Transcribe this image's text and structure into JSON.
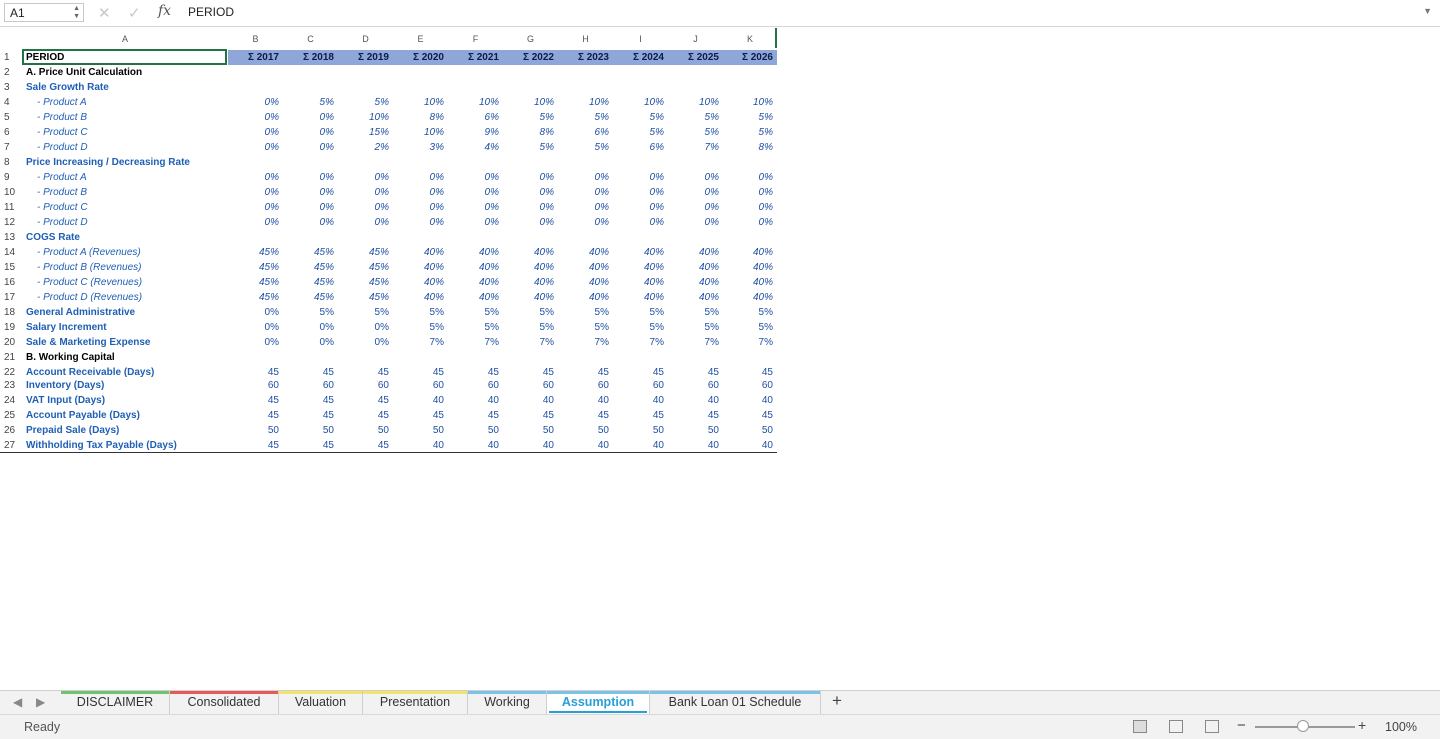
{
  "formula_bar": {
    "cell_ref": "A1",
    "fx": "fx",
    "formula": "PERIOD"
  },
  "columns": [
    "A",
    "B",
    "C",
    "D",
    "E",
    "F",
    "G",
    "H",
    "I",
    "J",
    "K"
  ],
  "header_row": {
    "label": "PERIOD",
    "years": [
      "Σ 2017",
      "Σ 2018",
      "Σ 2019",
      "Σ 2020",
      "Σ 2021",
      "Σ 2022",
      "Σ 2023",
      "Σ 2024",
      "Σ 2025",
      "Σ 2026"
    ]
  },
  "rows": [
    {
      "n": "1",
      "label": "PERIOD",
      "style": "header",
      "values": []
    },
    {
      "n": "2",
      "label": "A. Price Unit Calculation",
      "style": "black",
      "values": []
    },
    {
      "n": "3",
      "label": "Sale Growth Rate",
      "style": "blue",
      "values": []
    },
    {
      "n": "4",
      "label": "- Product A",
      "style": "sub",
      "pct": true,
      "values": [
        "0%",
        "5%",
        "5%",
        "10%",
        "10%",
        "10%",
        "10%",
        "10%",
        "10%",
        "10%"
      ]
    },
    {
      "n": "5",
      "label": "- Product B",
      "style": "sub",
      "pct": true,
      "values": [
        "0%",
        "0%",
        "10%",
        "8%",
        "6%",
        "5%",
        "5%",
        "5%",
        "5%",
        "5%"
      ]
    },
    {
      "n": "6",
      "label": "- Product C",
      "style": "sub",
      "pct": true,
      "values": [
        "0%",
        "0%",
        "15%",
        "10%",
        "9%",
        "8%",
        "6%",
        "5%",
        "5%",
        "5%"
      ]
    },
    {
      "n": "7",
      "label": "- Product D",
      "style": "sub",
      "pct": true,
      "values": [
        "0%",
        "0%",
        "2%",
        "3%",
        "4%",
        "5%",
        "5%",
        "6%",
        "7%",
        "8%"
      ]
    },
    {
      "n": "8",
      "label": "Price Increasing / Decreasing Rate",
      "style": "blue",
      "values": []
    },
    {
      "n": "9",
      "label": "- Product A",
      "style": "sub",
      "pct": true,
      "values": [
        "0%",
        "0%",
        "0%",
        "0%",
        "0%",
        "0%",
        "0%",
        "0%",
        "0%",
        "0%"
      ]
    },
    {
      "n": "10",
      "label": "- Product B",
      "style": "sub",
      "pct": true,
      "values": [
        "0%",
        "0%",
        "0%",
        "0%",
        "0%",
        "0%",
        "0%",
        "0%",
        "0%",
        "0%"
      ]
    },
    {
      "n": "11",
      "label": "- Product C",
      "style": "sub",
      "pct": true,
      "values": [
        "0%",
        "0%",
        "0%",
        "0%",
        "0%",
        "0%",
        "0%",
        "0%",
        "0%",
        "0%"
      ]
    },
    {
      "n": "12",
      "label": "- Product D",
      "style": "sub",
      "pct": true,
      "values": [
        "0%",
        "0%",
        "0%",
        "0%",
        "0%",
        "0%",
        "0%",
        "0%",
        "0%",
        "0%"
      ]
    },
    {
      "n": "13",
      "label": "COGS Rate",
      "style": "blue",
      "values": []
    },
    {
      "n": "14",
      "label": "- Product A (Revenues)",
      "style": "sub",
      "pct": true,
      "values": [
        "45%",
        "45%",
        "45%",
        "40%",
        "40%",
        "40%",
        "40%",
        "40%",
        "40%",
        "40%"
      ]
    },
    {
      "n": "15",
      "label": "- Product B (Revenues)",
      "style": "sub",
      "pct": true,
      "values": [
        "45%",
        "45%",
        "45%",
        "40%",
        "40%",
        "40%",
        "40%",
        "40%",
        "40%",
        "40%"
      ]
    },
    {
      "n": "16",
      "label": "- Product C (Revenues)",
      "style": "sub",
      "pct": true,
      "values": [
        "45%",
        "45%",
        "45%",
        "40%",
        "40%",
        "40%",
        "40%",
        "40%",
        "40%",
        "40%"
      ]
    },
    {
      "n": "17",
      "label": "- Product D (Revenues)",
      "style": "sub",
      "pct": true,
      "values": [
        "45%",
        "45%",
        "45%",
        "40%",
        "40%",
        "40%",
        "40%",
        "40%",
        "40%",
        "40%"
      ]
    },
    {
      "n": "18",
      "label": "General Administrative",
      "style": "blue",
      "values": [
        "0%",
        "5%",
        "5%",
        "5%",
        "5%",
        "5%",
        "5%",
        "5%",
        "5%",
        "5%"
      ]
    },
    {
      "n": "19",
      "label": "Salary Increment",
      "style": "blue",
      "values": [
        "0%",
        "0%",
        "0%",
        "5%",
        "5%",
        "5%",
        "5%",
        "5%",
        "5%",
        "5%"
      ]
    },
    {
      "n": "20",
      "label": "Sale & Marketing Expense",
      "style": "blue",
      "values": [
        "0%",
        "0%",
        "0%",
        "7%",
        "7%",
        "7%",
        "7%",
        "7%",
        "7%",
        "7%"
      ]
    },
    {
      "n": "21",
      "label": "B. Working Capital",
      "style": "black",
      "values": []
    },
    {
      "n": "22",
      "label": "Account Receivable (Days)",
      "style": "blue",
      "values": [
        "45",
        "45",
        "45",
        "45",
        "45",
        "45",
        "45",
        "45",
        "45",
        "45"
      ]
    },
    {
      "n": "23",
      "label": "Inventory (Days)",
      "style": "blue",
      "values": [
        "60",
        "60",
        "60",
        "60",
        "60",
        "60",
        "60",
        "60",
        "60",
        "60"
      ]
    },
    {
      "n": "24",
      "label": "VAT Input (Days)",
      "style": "blue",
      "values": [
        "45",
        "45",
        "45",
        "40",
        "40",
        "40",
        "40",
        "40",
        "40",
        "40"
      ]
    },
    {
      "n": "25",
      "label": "Account Payable (Days)",
      "style": "blue",
      "values": [
        "45",
        "45",
        "45",
        "45",
        "45",
        "45",
        "45",
        "45",
        "45",
        "45"
      ]
    },
    {
      "n": "26",
      "label": "Prepaid Sale (Days)",
      "style": "blue",
      "values": [
        "50",
        "50",
        "50",
        "50",
        "50",
        "50",
        "50",
        "50",
        "50",
        "50"
      ]
    },
    {
      "n": "27",
      "label": "Withholding Tax Payable (Days)",
      "style": "blue",
      "values": [
        "45",
        "45",
        "45",
        "40",
        "40",
        "40",
        "40",
        "40",
        "40",
        "40"
      ]
    }
  ],
  "sheet_tabs": [
    {
      "label": "DISCLAIMER",
      "color": "#6fc46f",
      "active": false
    },
    {
      "label": "Consolidated",
      "color": "#e45b5b",
      "active": false
    },
    {
      "label": "Valuation",
      "color": "#f2e36b",
      "active": false
    },
    {
      "label": "Presentation",
      "color": "#f2e36b",
      "active": false
    },
    {
      "label": "Working",
      "color": "#7cc1e8",
      "active": false
    },
    {
      "label": "Assumption",
      "color": "#7cc1e8",
      "active": true
    },
    {
      "label": "Bank Loan 01 Schedule",
      "color": "#7cc1e8",
      "active": false
    }
  ],
  "add_sheet": "+",
  "status": {
    "ready": "Ready",
    "zoom": "100%",
    "zoom_minus": "−",
    "zoom_plus": "+"
  }
}
